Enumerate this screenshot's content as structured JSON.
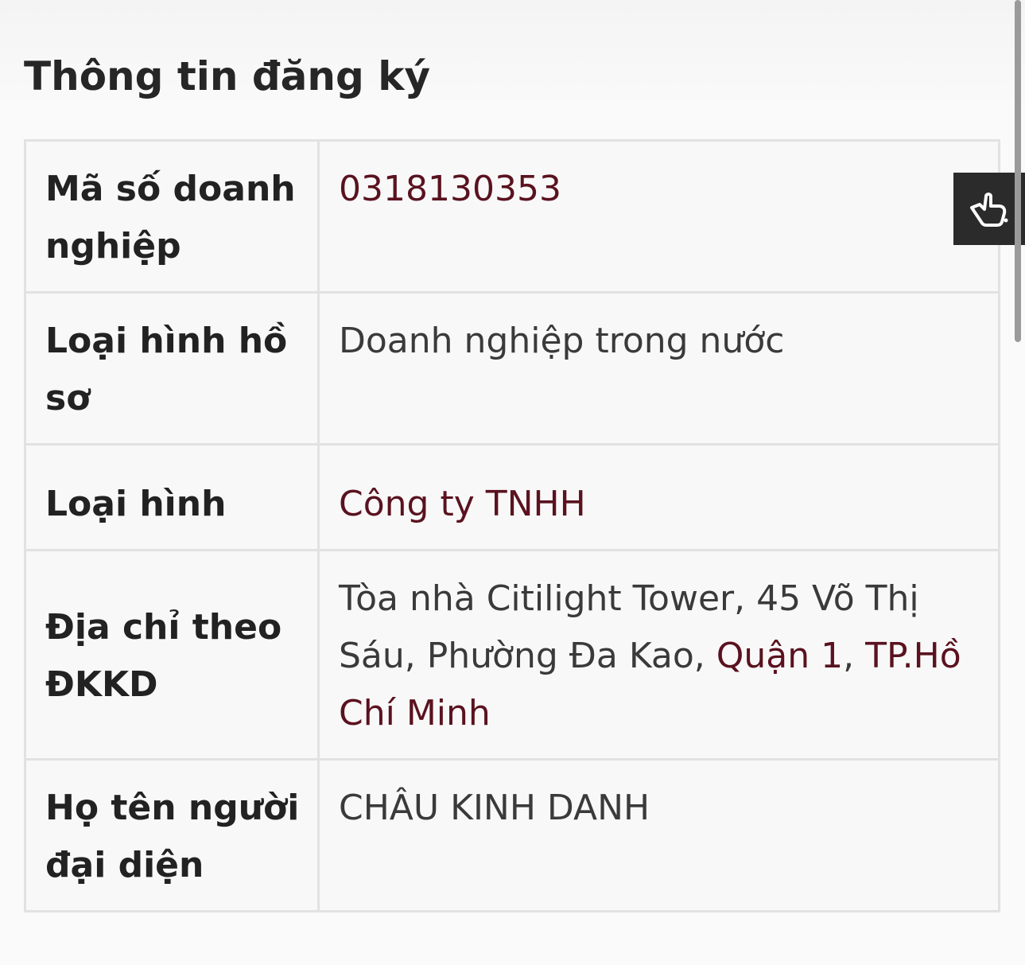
{
  "section": {
    "title": "Thông tin đăng ký"
  },
  "rows": {
    "business_code": {
      "label": "Mã số doanh nghiệp",
      "value": "0318130353"
    },
    "profile_type": {
      "label": "Loại hình hồ sơ",
      "value": "Doanh nghiệp trong nước"
    },
    "business_type": {
      "label": "Loại hình",
      "value": "Công ty TNHH"
    },
    "address": {
      "label": "Địa chỉ theo ĐKKD",
      "value_prefix": "Tòa nhà Citilight Tower, 45 Võ Thị Sáu, Phường Đa Kao, ",
      "district": "Quận 1",
      "separator": ",",
      "city": "TP.Hồ Chí Minh"
    },
    "representative": {
      "label": "Họ tên người đại diện",
      "value": "CHÂU KINH DANH"
    }
  },
  "icons": {
    "floating_button": "pointer-hand-icon"
  },
  "colors": {
    "link": "#5a121f",
    "floating_button_bg": "#2b2b2b",
    "border": "#e2e2e2"
  }
}
